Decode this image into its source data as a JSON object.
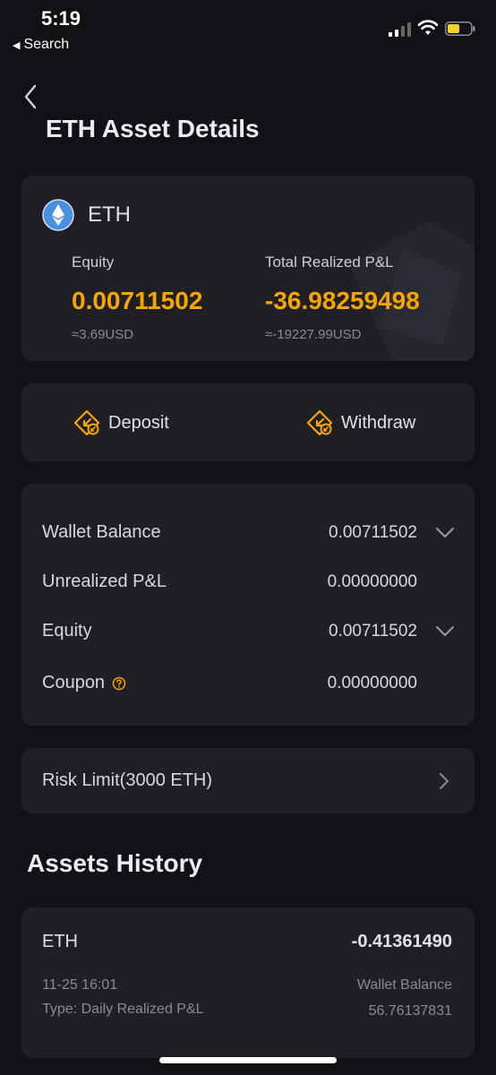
{
  "status": {
    "time": "5:19",
    "back_label": "Search",
    "back_glyph": "◀"
  },
  "page": {
    "title": "ETH Asset Details"
  },
  "coin": {
    "name": "ETH",
    "equity_label": "Equity",
    "equity_value": "0.00711502",
    "equity_usd": "≈3.69USD",
    "realized_label": "Total Realized P&L",
    "realized_value": "-36.98259498",
    "realized_usd": "≈-19227.99USD"
  },
  "actions": {
    "deposit": "Deposit",
    "withdraw": "Withdraw"
  },
  "balances": [
    {
      "label": "Wallet Balance",
      "value": "0.00711502",
      "expandable": true
    },
    {
      "label": "Unrealized P&L",
      "value": "0.00000000",
      "expandable": false
    },
    {
      "label": "Equity",
      "value": "0.00711502",
      "expandable": true
    },
    {
      "label": "Coupon",
      "value": "0.00000000",
      "expandable": false,
      "help_icon": "question-circle-icon"
    }
  ],
  "risk": {
    "label": "Risk Limit(3000 ETH)"
  },
  "history": {
    "title": "Assets History",
    "items": [
      {
        "coin": "ETH",
        "amount": "-0.41361490",
        "time": "11-25 16:01",
        "type": "Type:  Daily Realized P&L",
        "balance_label": "Wallet Balance",
        "balance_value": "56.76137831"
      }
    ]
  },
  "colors": {
    "accent": "#f7a600",
    "background": "#121216",
    "card": "#1f1f25",
    "eth_blue": "#4a90e2"
  }
}
